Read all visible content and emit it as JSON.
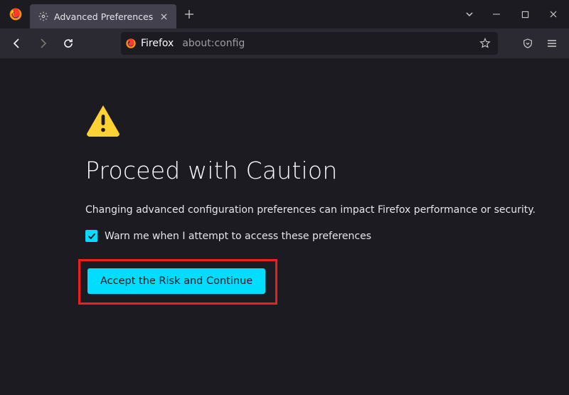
{
  "tab": {
    "title": "Advanced Preferences"
  },
  "urlbar": {
    "host": "Firefox",
    "path": "about:config"
  },
  "page": {
    "heading": "Proceed with Caution",
    "description": "Changing advanced configuration preferences can impact Firefox performance or security.",
    "checkbox_label": "Warn me when I attempt to access these preferences",
    "accept_label": "Accept the Risk and Continue"
  }
}
